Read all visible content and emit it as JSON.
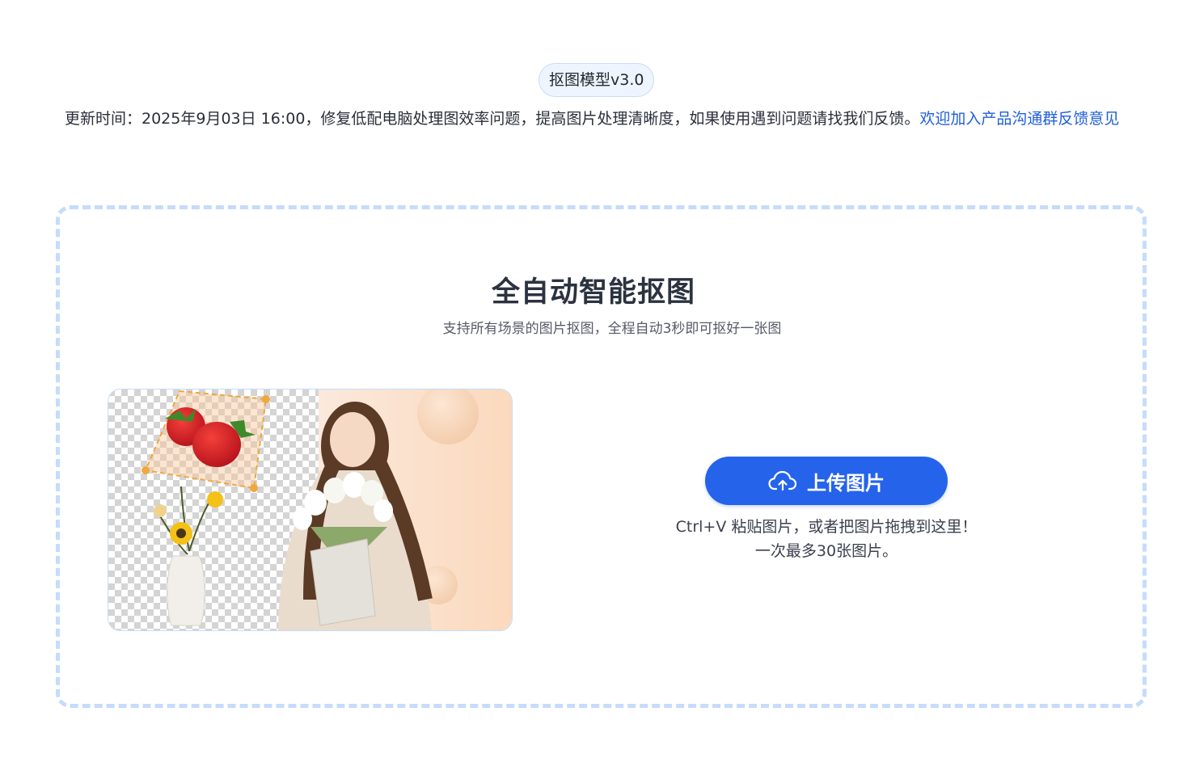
{
  "header": {
    "version_badge": "抠图模型v3.0",
    "update_text": "更新时间：2025年9月03日 16:00，修复低配电脑处理图效率问题，提高图片处理清晰度，如果使用遇到问题请找我们反馈。",
    "feedback_link": "欢迎加入产品沟通群反馈意见"
  },
  "main": {
    "title": "全自动智能抠图",
    "subtitle": "支持所有场景的图片抠图，全程自动3秒即可抠好一张图"
  },
  "upload": {
    "button_label": "上传图片",
    "button_icon": "cloud-upload-icon",
    "hint_line1": "Ctrl+V 粘贴图片，或者把图片拖拽到这里！",
    "hint_line2": "一次最多30张图片。"
  },
  "colors": {
    "accent": "#2563eb",
    "link": "#1f5fdc",
    "dashed_border": "#c5dcfb",
    "badge_bg": "#eef5ff"
  }
}
